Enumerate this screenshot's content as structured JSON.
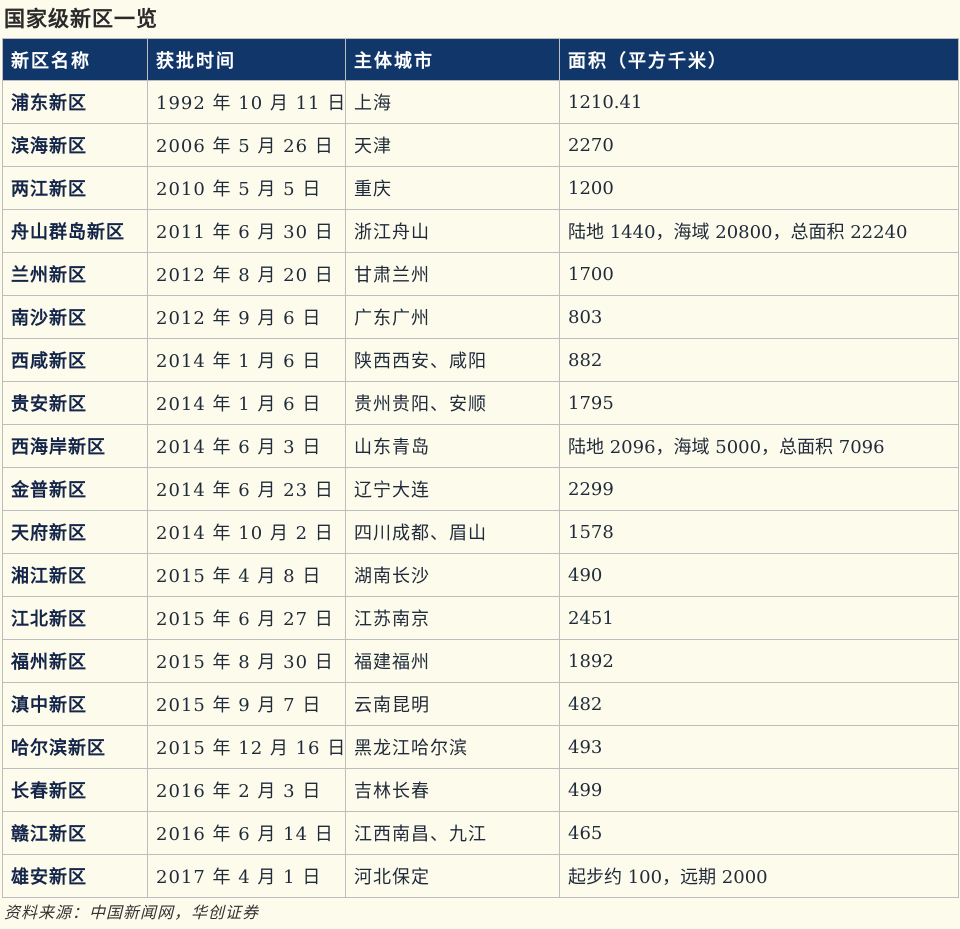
{
  "title": "国家级新区一览",
  "table": {
    "headers": [
      "新区名称",
      "获批时间",
      "主体城市",
      "面积（平方千米）"
    ],
    "rows": [
      [
        "浦东新区",
        "1992 年 10 月 11 日",
        "上海",
        "1210.41"
      ],
      [
        "滨海新区",
        "2006 年 5 月 26 日",
        "天津",
        "2270"
      ],
      [
        "两江新区",
        "2010 年 5 月 5 日",
        "重庆",
        "1200"
      ],
      [
        "舟山群岛新区",
        "2011 年 6 月 30 日",
        "浙江舟山",
        "陆地 1440，海域 20800，总面积 22240"
      ],
      [
        "兰州新区",
        "2012 年 8 月 20 日",
        "甘肃兰州",
        "1700"
      ],
      [
        "南沙新区",
        "2012 年 9 月 6 日",
        "广东广州",
        "803"
      ],
      [
        "西咸新区",
        "2014 年 1 月 6 日",
        "陕西西安、咸阳",
        "882"
      ],
      [
        "贵安新区",
        "2014 年 1 月 6 日",
        "贵州贵阳、安顺",
        "1795"
      ],
      [
        "西海岸新区",
        "2014 年 6 月 3 日",
        "山东青岛",
        "陆地 2096，海域 5000，总面积 7096"
      ],
      [
        "金普新区",
        "2014 年 6 月 23 日",
        "辽宁大连",
        "2299"
      ],
      [
        "天府新区",
        "2014 年 10 月 2 日",
        "四川成都、眉山",
        "1578"
      ],
      [
        "湘江新区",
        "2015 年 4 月 8 日",
        "湖南长沙",
        "490"
      ],
      [
        "江北新区",
        "2015 年 6 月 27 日",
        "江苏南京",
        "2451"
      ],
      [
        "福州新区",
        "2015 年 8 月 30 日",
        "福建福州",
        "1892"
      ],
      [
        "滇中新区",
        "2015 年 9 月 7 日",
        "云南昆明",
        "482"
      ],
      [
        "哈尔滨新区",
        "2015 年 12 月 16 日",
        "黑龙江哈尔滨",
        "493"
      ],
      [
        "长春新区",
        "2016 年 2 月 3 日",
        "吉林长春",
        "499"
      ],
      [
        "赣江新区",
        "2016 年 6 月 14 日",
        "江西南昌、九江",
        "465"
      ],
      [
        "雄安新区",
        "2017 年 4 月 1 日",
        "河北保定",
        "起步约 100，远期 2000"
      ]
    ]
  },
  "source": "资料来源：中国新闻网，华创证券",
  "colors": {
    "header_bg": "#11376a",
    "header_text": "#ffffff",
    "page_bg": "#fdfbeb",
    "grid_line": "#bdbdbd"
  }
}
